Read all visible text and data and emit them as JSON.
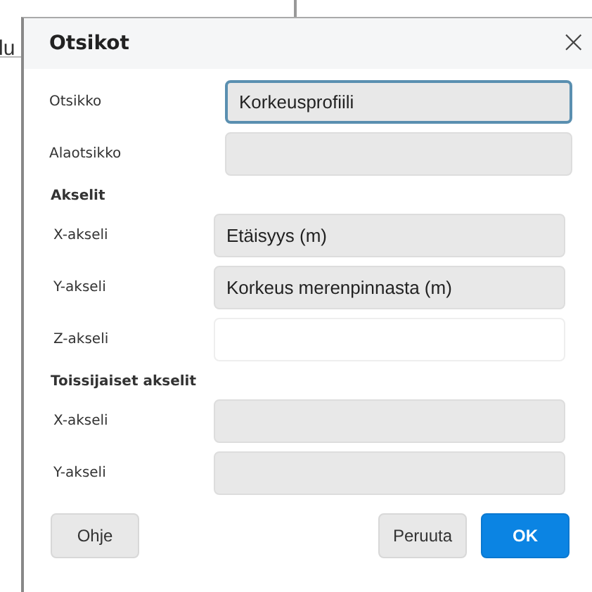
{
  "background": {
    "text": "lu"
  },
  "dialog": {
    "title": "Otsikot",
    "close": "×",
    "sections": [
      {
        "fields": [
          {
            "label": "Otsikko",
            "value": "Korkeusprofiili",
            "focused": true,
            "disabled": false
          },
          {
            "label": "Alaotsikko",
            "focused": false,
            "disabled": true
          }
        ]
      },
      {
        "heading": "Akselit",
        "fields": [
          {
            "label": "X-akseli",
            "value": "Etäisyys (m)",
            "focused": false,
            "disabled": true
          },
          {
            "label": "Y-akseli",
            "value": "Korkeus merenpinnasta (m)",
            "focused": false,
            "disabled": true
          },
          {
            "label": "Z-akseli",
            "focused": false,
            "disabled": false
          }
        ]
      },
      {
        "heading": "Toissijaiset akselit",
        "fields": [
          {
            "label": "X-akseli",
            "focused": false,
            "disabled": true
          },
          {
            "label": "Y-akseli",
            "focused": false,
            "disabled": true
          }
        ]
      }
    ],
    "buttons": [
      {
        "label": "Ohje",
        "kind": "help"
      },
      {
        "label": "Peruuta",
        "kind": "cancel"
      },
      {
        "label": "OK",
        "kind": "default"
      }
    ]
  }
}
